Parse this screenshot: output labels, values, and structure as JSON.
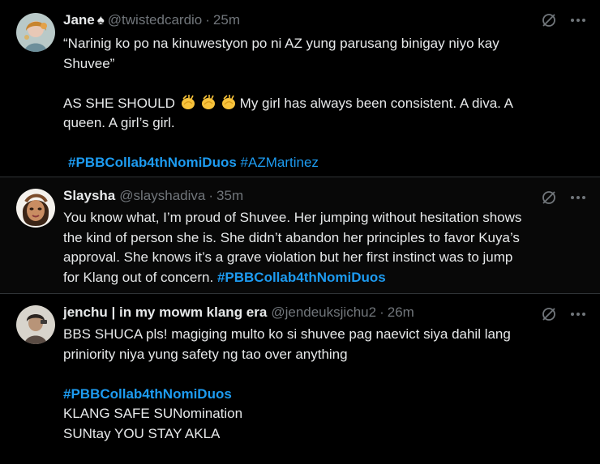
{
  "tweets": [
    {
      "name": "Jane",
      "badge": "♠",
      "handle": "@twistedcardio",
      "time": "25m",
      "line1": "“Narinig ko po na kinuwestyon po ni AZ yung parusang binigay niyo kay",
      "line2": "Shuvee”",
      "line3_a": "AS SHE SHOULD ",
      "line3_b": "My girl has always been consistent. A diva. A",
      "line4": "queen. A girl’s girl.",
      "tags": [
        "#PBBCollab4thNomiDuos",
        "#AZMartinez"
      ]
    },
    {
      "name": "Slaysha",
      "handle": "@slayshadiva",
      "time": "35m",
      "lines": [
        "You know what, I’m proud of Shuvee. Her jumping without hesitation shows",
        "the kind of person she is. She didn’t abandon her principles to favor Kuya’s",
        "approval. She knows it’s a grave violation but her first instinct was to jump"
      ],
      "line4": "for Klang out of concern. ",
      "tag": "#PBBCollab4thNomiDuos"
    },
    {
      "name": "jenchu | in my mowm klang era",
      "handle": "@jendeuksjichu2",
      "time": "26m",
      "line1": "BBS SHUCA pls! magiging multo ko si shuvee pag naevict siya dahil lang",
      "line2": "priniority niya yung safety ng tao over anything",
      "tag": "#PBBCollab4thNomiDuos",
      "line4": "KLANG SAFE SUNomination",
      "line5": "SUNtay YOU STAY AKLA"
    }
  ],
  "icons": {
    "grok": "grok-icon",
    "more": "more-icon",
    "clap": "clapping-hands-emoji"
  }
}
